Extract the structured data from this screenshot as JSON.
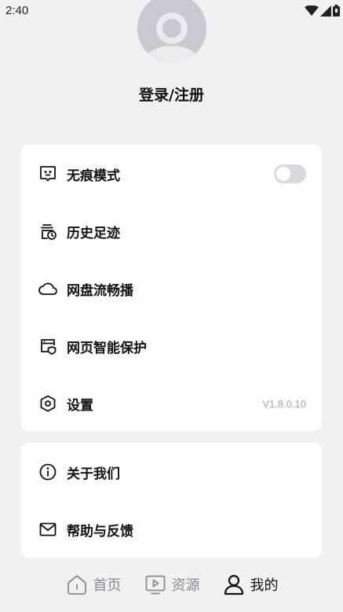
{
  "status_bar": {
    "time": "2:40"
  },
  "profile": {
    "login_label": "登录/注册"
  },
  "menu_main": [
    {
      "label": "无痕模式",
      "icon": "incognito-icon",
      "toggle_on": false
    },
    {
      "label": "历史足迹",
      "icon": "history-icon"
    },
    {
      "label": "网盘流畅播",
      "icon": "cloud-icon"
    },
    {
      "label": "网页智能保护",
      "icon": "shield-browser-icon"
    },
    {
      "label": "设置",
      "icon": "settings-icon",
      "meta": "V1.8.0.10"
    }
  ],
  "menu_secondary": [
    {
      "label": "关于我们",
      "icon": "info-icon"
    },
    {
      "label": "帮助与反馈",
      "icon": "mail-icon"
    }
  ],
  "bottom_nav": [
    {
      "label": "首页",
      "icon": "home-icon",
      "active": false
    },
    {
      "label": "资源",
      "icon": "play-icon",
      "active": false
    },
    {
      "label": "我的",
      "icon": "user-icon",
      "active": true
    }
  ]
}
